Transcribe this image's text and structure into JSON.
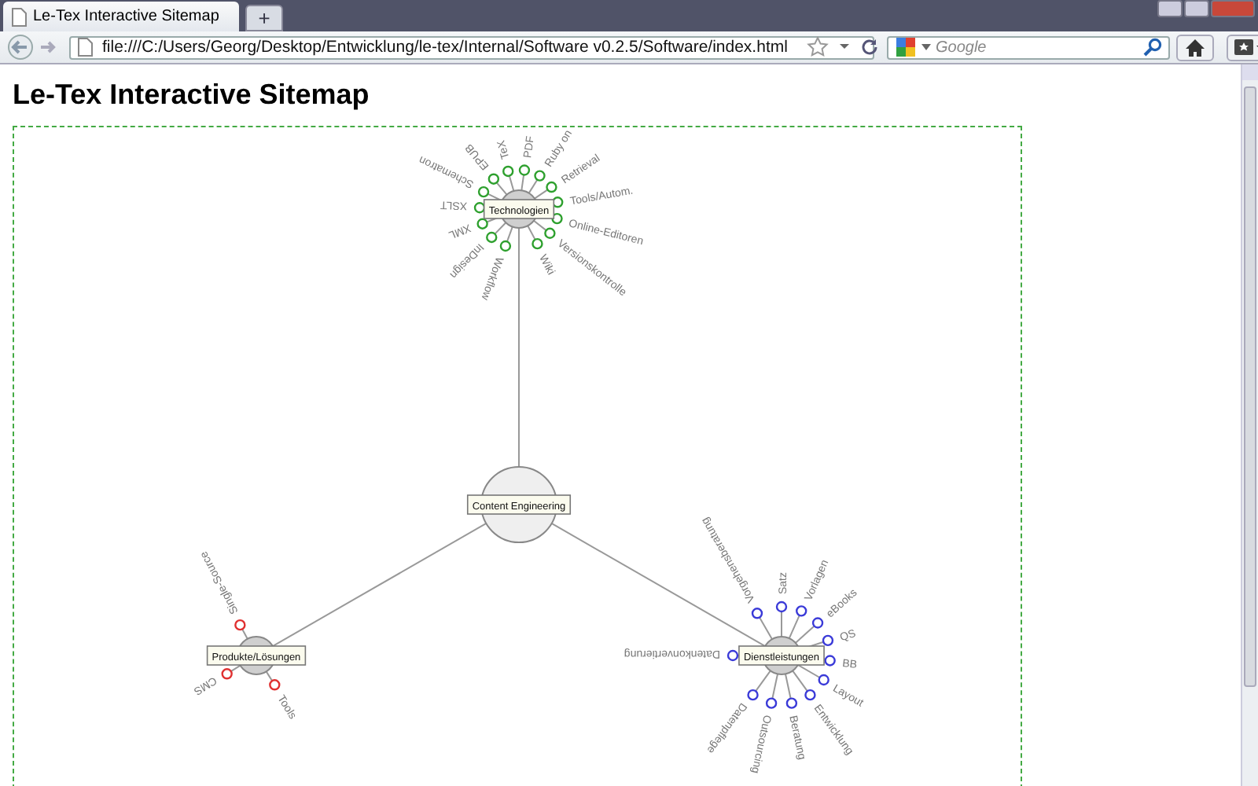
{
  "browser": {
    "tab_title": "Le-Tex Interactive Sitemap",
    "new_tab": "+",
    "url": "file:///C:/Users/Georg/Desktop/Entwicklung/le-tex/Internal/Software v0.2.5/Software/index.html",
    "search_placeholder": "Google"
  },
  "page": {
    "title": "Le-Tex Interactive Sitemap"
  },
  "sitemap": {
    "root": {
      "label": "Content Engineering",
      "children": [
        {
          "label": "Technologien",
          "color": "#2ea02e",
          "children": [
            {
              "label": "Workflow"
            },
            {
              "label": "InDesign"
            },
            {
              "label": "XML"
            },
            {
              "label": "XSLT"
            },
            {
              "label": "Schematron"
            },
            {
              "label": "EPUB"
            },
            {
              "label": "TeX"
            },
            {
              "label": "PDF"
            },
            {
              "label": "Ruby on"
            },
            {
              "label": "Retrieval"
            },
            {
              "label": "Tools/Autom."
            },
            {
              "label": "Online-Editoren"
            },
            {
              "label": "Versionskontrolle"
            },
            {
              "label": "Wiki"
            }
          ]
        },
        {
          "label": "Produkte/Lösungen",
          "color": "#e03030",
          "children": [
            {
              "label": "Single-Source"
            },
            {
              "label": "CMS"
            },
            {
              "label": "Tools"
            }
          ]
        },
        {
          "label": "Dienstleistungen",
          "color": "#3a3ad8",
          "children": [
            {
              "label": "Satz"
            },
            {
              "label": "Vorlagen"
            },
            {
              "label": "eBooks"
            },
            {
              "label": "QS"
            },
            {
              "label": "BB"
            },
            {
              "label": "Layout"
            },
            {
              "label": "Entwicklung"
            },
            {
              "label": "Beratung"
            },
            {
              "label": "Outsourcing"
            },
            {
              "label": "Datenpflege"
            },
            {
              "label": "Datenkonvertierung"
            },
            {
              "label": "Vorgehensberatung"
            }
          ]
        }
      ]
    }
  }
}
